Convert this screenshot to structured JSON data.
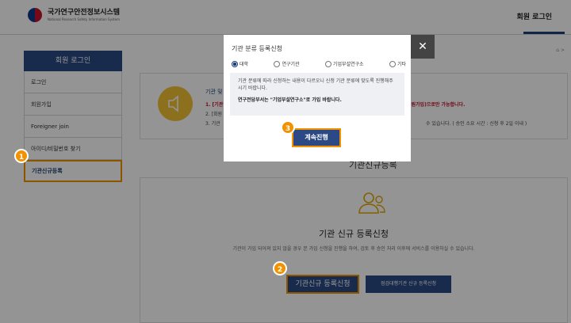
{
  "header": {
    "logo_title": "국가연구안전정보시스템",
    "logo_sub": "National Research Safety Information System",
    "login_link": "회원 로그인"
  },
  "sidebar": {
    "title": "회원 로그인",
    "items": [
      {
        "label": "로그인"
      },
      {
        "label": "회원가입"
      },
      {
        "label": "Foreigner join"
      },
      {
        "label": "아이디/비밀번호 찾기"
      },
      {
        "label": "기관신규등록"
      }
    ]
  },
  "breadcrumb": "⌂ >",
  "notice": {
    "title": "기관 및",
    "lines": [
      "1. [기관",
      "2. [회원",
      "3. 기관"
    ],
    "frag1": "회원가입)으로만 가능합니다.",
    "frag2": "수 있습니다. ( 승인 소요 시간 : 신청 후 2일 이내 )"
  },
  "registration": {
    "heading": "기관신규등록",
    "title": "기관 신규 등록신청",
    "description": "기관이 가입 되어져 있지 않을 경우 본 가입 신청을 진행을 하여, 검토 후 승인 처리 이후에 서비스를 이용하실 수 있습니다.",
    "apply_button": "기관신규 등록신청",
    "inspection_button": "점검대행기관 신규 등록신청"
  },
  "modal": {
    "title": "기관 분류 등록신청",
    "close_symbol": "✕",
    "options": [
      {
        "label": "대학",
        "selected": true
      },
      {
        "label": "연구기관",
        "selected": false
      },
      {
        "label": "기업부설연구소",
        "selected": false
      },
      {
        "label": "기타",
        "selected": false
      }
    ],
    "info_line": "기관 분류에 따라 신청하는 내용이 다르오니 신청 기관 분류에 맞도록 진행해주시기 바랍니다.",
    "info_bold": "연구전담부서는 \"기업부설연구소\"로 가입 바랍니다.",
    "continue_button": "계속진행"
  },
  "markers": {
    "m1": "1",
    "m2": "2",
    "m3": "3"
  },
  "colors": {
    "brand": "#2b4a85",
    "highlight": "#f39200"
  }
}
